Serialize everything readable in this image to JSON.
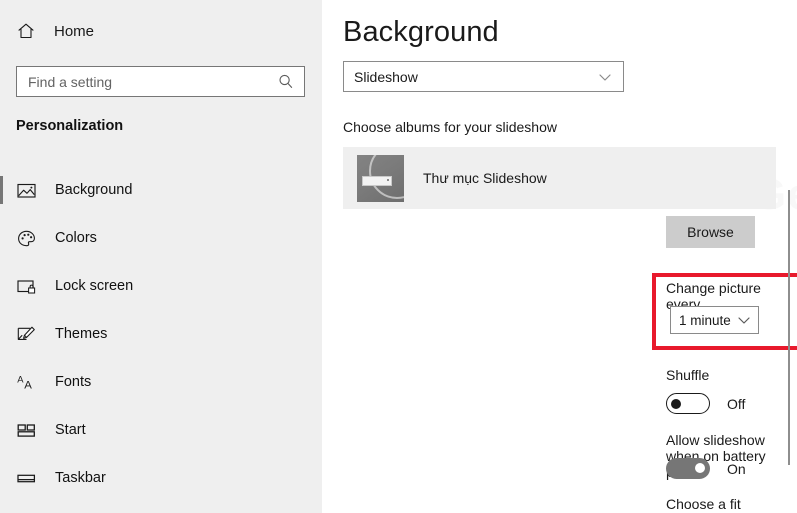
{
  "sidebar": {
    "home": {
      "label": "Home",
      "icon": "home-icon"
    },
    "search": {
      "placeholder": "Find a setting",
      "value": "",
      "icon": "search-icon"
    },
    "section_title": "Personalization",
    "items": [
      {
        "label": "Background",
        "icon": "picture-icon",
        "selected": true
      },
      {
        "label": "Colors",
        "icon": "palette-icon",
        "selected": false
      },
      {
        "label": "Lock screen",
        "icon": "lock-screen-icon",
        "selected": false
      },
      {
        "label": "Themes",
        "icon": "themes-brush-icon",
        "selected": false
      },
      {
        "label": "Fonts",
        "icon": "fonts-aa-icon",
        "selected": false
      },
      {
        "label": "Start",
        "icon": "start-tiles-icon",
        "selected": false
      },
      {
        "label": "Taskbar",
        "icon": "taskbar-icon",
        "selected": false
      }
    ]
  },
  "main": {
    "title": "Background",
    "background_type": {
      "value": "Slideshow",
      "icon": "chevron-down-icon"
    },
    "albums": {
      "label": "Choose albums for your slideshow",
      "folder_name": "Thư mục Slideshow",
      "browse_label": "Browse"
    },
    "watermark": "GearnRao",
    "interval": {
      "label": "Change picture every",
      "value": "1 minute",
      "icon": "chevron-down-icon",
      "highlight_color": "#e8192c"
    },
    "shuffle": {
      "label": "Shuffle",
      "state": "Off",
      "on": false
    },
    "battery": {
      "label": "Allow slideshow when on battery power",
      "state": "On",
      "on": true
    },
    "fit": {
      "label": "Choose a fit"
    }
  }
}
